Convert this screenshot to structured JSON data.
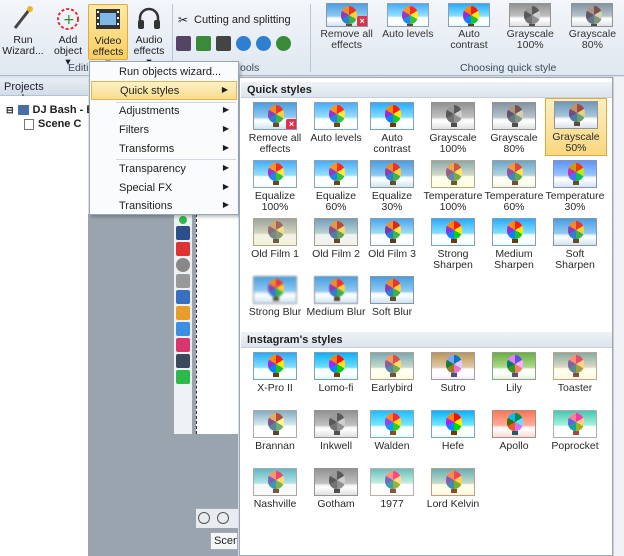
{
  "ribbon": {
    "run_wizard": "Run Wizard...",
    "add_object": "Add object",
    "video_effects": "Video effects",
    "audio_effects": "Audio effects",
    "cutting": "Cutting and splitting",
    "group_editing": "Editi",
    "group_tools": "ools",
    "group_quick": "Choosing quick style",
    "gallery": [
      "Remove all effects",
      "Auto levels",
      "Auto contrast",
      "Grayscale 100%",
      "Grayscale 80%"
    ]
  },
  "projects": {
    "header": "Projects explorer",
    "root": "DJ Bash - B",
    "scene": "Scene C"
  },
  "scene_tab": "Scen",
  "menu": {
    "items": [
      {
        "label": "Run objects wizard..."
      },
      {
        "label": "Quick styles"
      },
      {
        "label": "Adjustments"
      },
      {
        "label": "Filters"
      },
      {
        "label": "Transforms"
      },
      {
        "label": "Transparency"
      },
      {
        "label": "Special FX"
      },
      {
        "label": "Transitions"
      }
    ]
  },
  "quick_styles": {
    "header": "Quick styles",
    "items": [
      "Remove all effects",
      "Auto levels",
      "Auto contrast",
      "Grayscale 100%",
      "Grayscale 80%",
      "Grayscale 50%",
      "Equalize 100%",
      "Equalize 60%",
      "Equalize 30%",
      "Temperature 100%",
      "Temperature 60%",
      "Temperature 30%",
      "Old Film 1",
      "Old Film 2",
      "Old Film 3",
      "Strong Sharpen",
      "Medium Sharpen",
      "Soft Sharpen",
      "Strong Blur",
      "Medium Blur",
      "Soft Blur"
    ],
    "selected": "Grayscale 50%"
  },
  "instagram_styles": {
    "header": "Instagram's styles",
    "items": [
      "X-Pro II",
      "Lomo-fi",
      "Earlybird",
      "Sutro",
      "Lily",
      "Toaster",
      "Brannan",
      "Inkwell",
      "Walden",
      "Hefe",
      "Apollo",
      "Poprocket",
      "Nashville",
      "Gotham",
      "1977",
      "Lord Kelvin"
    ]
  }
}
